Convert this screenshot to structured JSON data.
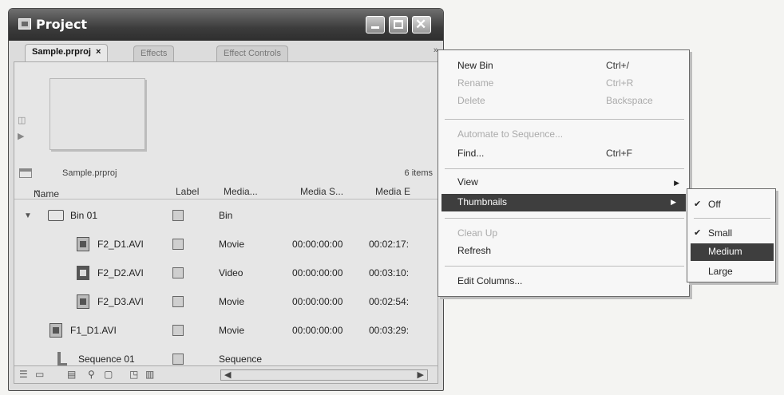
{
  "window": {
    "title": "Project"
  },
  "tabs": [
    {
      "label": "Sample.prproj",
      "close": "×"
    },
    {
      "label": "Effects"
    },
    {
      "label": "Effect Controls"
    }
  ],
  "panel_menu_button": "»",
  "bin_bar": {
    "name": "Sample.prproj",
    "items": "6 items"
  },
  "columns": [
    "Name",
    "Label",
    "Media...",
    "Media S...",
    "Media E"
  ],
  "rows": [
    {
      "name": "Bin 01",
      "media": "Bin",
      "start": "",
      "end": ""
    },
    {
      "name": "F2_D1.AVI",
      "media": "Movie",
      "start": "00:00:00:00",
      "end": "00:02:17:"
    },
    {
      "name": "F2_D2.AVI",
      "media": "Video",
      "start": "00:00:00:00",
      "end": "00:03:10:"
    },
    {
      "name": "F2_D3.AVI",
      "media": "Movie",
      "start": "00:00:00:00",
      "end": "00:02:54:"
    },
    {
      "name": "F1_D1.AVI",
      "media": "Movie",
      "start": "00:00:00:00",
      "end": "00:03:29:"
    },
    {
      "name": "Sequence 01",
      "media": "Sequence",
      "start": "",
      "end": ""
    }
  ],
  "menu": {
    "new_bin": "New Bin",
    "new_bin_sc": "Ctrl+/",
    "rename": "Rename",
    "rename_sc": "Ctrl+R",
    "delete": "Delete",
    "delete_sc": "Backspace",
    "automate": "Automate to Sequence...",
    "find": "Find...",
    "find_sc": "Ctrl+F",
    "view": "View",
    "thumbnails": "Thumbnails",
    "clean_up": "Clean Up",
    "refresh": "Refresh",
    "edit_columns": "Edit Columns..."
  },
  "submenu": {
    "off": "Off",
    "small": "Small",
    "medium": "Medium",
    "large": "Large"
  },
  "colors": {
    "highlight": "#3e3e3e",
    "titlebar": "#3c3c3c"
  }
}
